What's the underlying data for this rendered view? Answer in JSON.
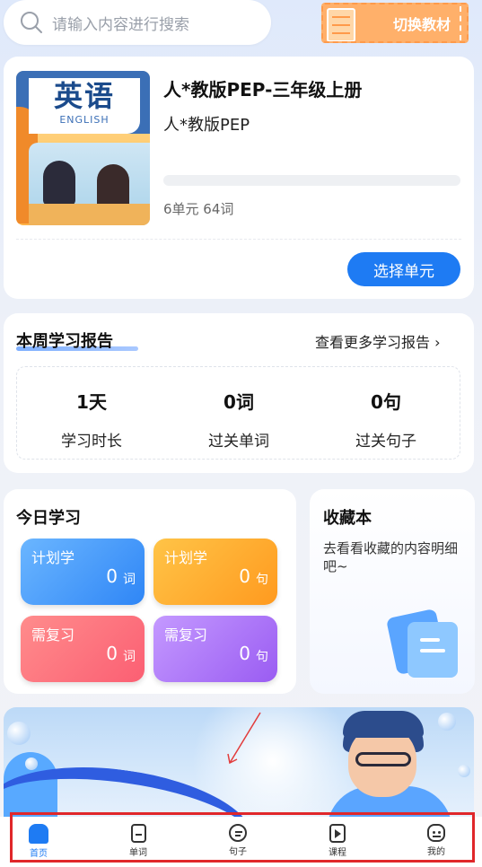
{
  "search": {
    "placeholder": "请输入内容进行搜索"
  },
  "switch_textbook": {
    "label": "切换教材"
  },
  "book": {
    "cover_title_cn": "英语",
    "cover_title_en": "ENGLISH",
    "title": "人*教版PEP-三年级上册",
    "publisher": "人*教版PEP",
    "meta": "6单元 64词",
    "progress": 0,
    "select_unit_label": "选择单元"
  },
  "report": {
    "title": "本周学习报告",
    "more_label": "查看更多学习报告",
    "stats": [
      {
        "value": "1天",
        "label": "学习时长"
      },
      {
        "value": "0词",
        "label": "过关单词"
      },
      {
        "value": "0句",
        "label": "过关句子"
      }
    ]
  },
  "today": {
    "title": "今日学习",
    "tiles": [
      {
        "label": "计划学",
        "count": "0",
        "unit": "词"
      },
      {
        "label": "计划学",
        "count": "0",
        "unit": "句"
      },
      {
        "label": "需复习",
        "count": "0",
        "unit": "词"
      },
      {
        "label": "需复习",
        "count": "0",
        "unit": "句"
      }
    ]
  },
  "favorites": {
    "title": "收藏本",
    "description": "去看看收藏的内容明细吧~"
  },
  "tabbar": {
    "items": [
      {
        "label": "首页",
        "icon": "home-icon",
        "active": true
      },
      {
        "label": "单词",
        "icon": "word-doc-icon"
      },
      {
        "label": "句子",
        "icon": "sentence-icon"
      },
      {
        "label": "课程",
        "icon": "course-play-icon"
      },
      {
        "label": "我的",
        "icon": "profile-icon"
      }
    ]
  },
  "colors": {
    "primary": "#1e7bf3",
    "highlight_outline": "#e0272a",
    "switch_orange": "#ffb06a"
  }
}
